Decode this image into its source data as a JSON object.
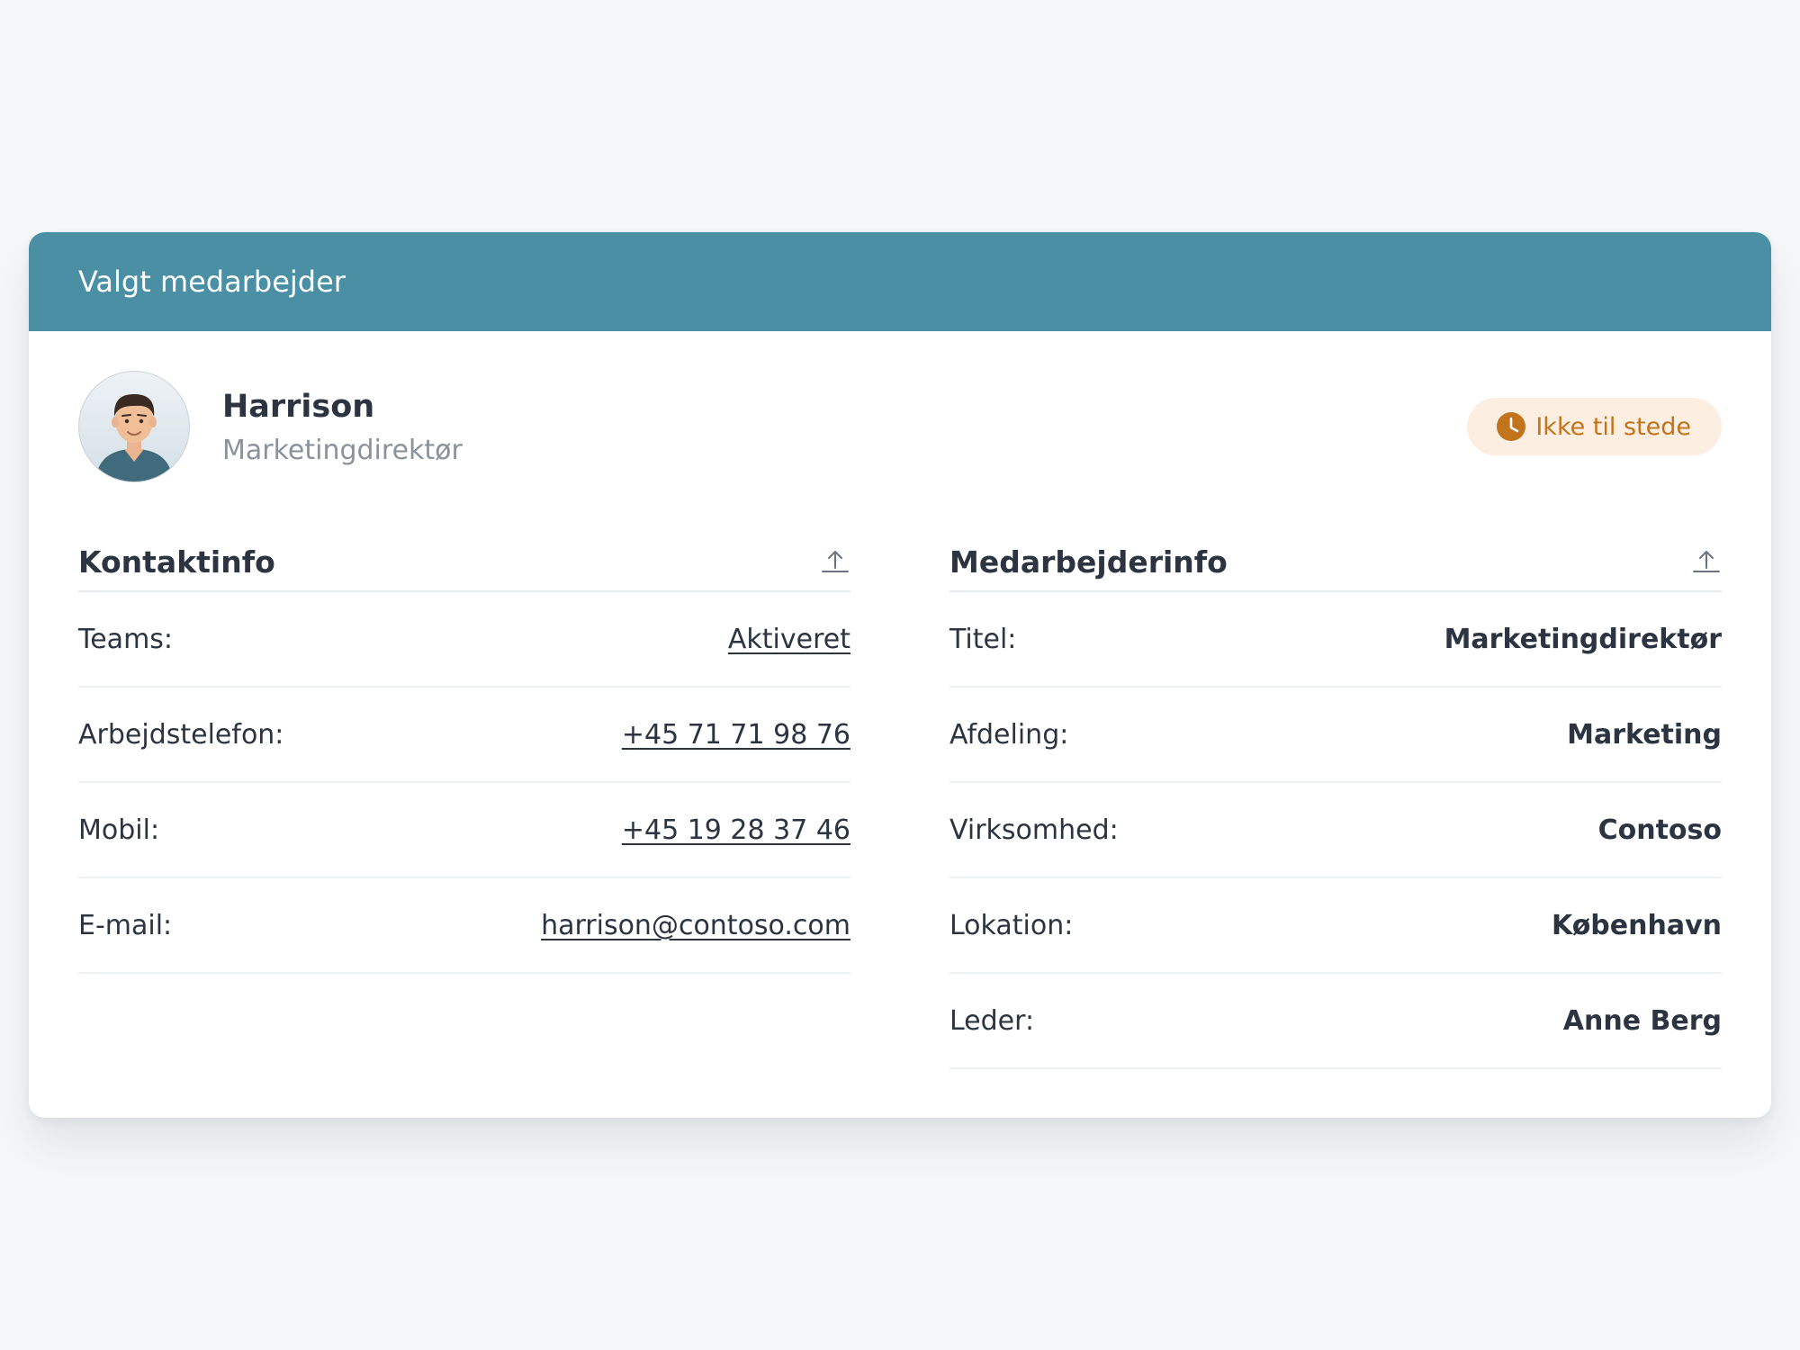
{
  "panel": {
    "title": "Valgt medarbejder"
  },
  "person": {
    "name": "Harrison",
    "job_title": "Marketingdirektør",
    "status": "Ikke til stede"
  },
  "contact": {
    "heading": "Kontaktinfo",
    "rows": [
      {
        "label": "Teams:",
        "value": "Aktiveret"
      },
      {
        "label": "Arbejdstelefon:",
        "value": "+45 71 71 98 76"
      },
      {
        "label": "Mobil:",
        "value": "+45 19 28 37 46"
      },
      {
        "label": "E-mail:",
        "value": "harrison@contoso.com"
      }
    ]
  },
  "employee": {
    "heading": "Medarbejderinfo",
    "rows": [
      {
        "label": "Titel:",
        "value": "Marketingdirektør"
      },
      {
        "label": "Afdeling:",
        "value": "Marketing"
      },
      {
        "label": "Virksomhed:",
        "value": "Contoso"
      },
      {
        "label": "Lokation:",
        "value": "København"
      },
      {
        "label": "Leder:",
        "value": "Anne Berg"
      }
    ]
  },
  "icons": {
    "status": "clock-icon",
    "section_toggle": "collapse-up-icon"
  },
  "colors": {
    "header": "#4a8fa4",
    "status_bg": "#fdeee2",
    "status_fg": "#c2741c",
    "text": "#2b3440",
    "muted": "#8a939b"
  }
}
